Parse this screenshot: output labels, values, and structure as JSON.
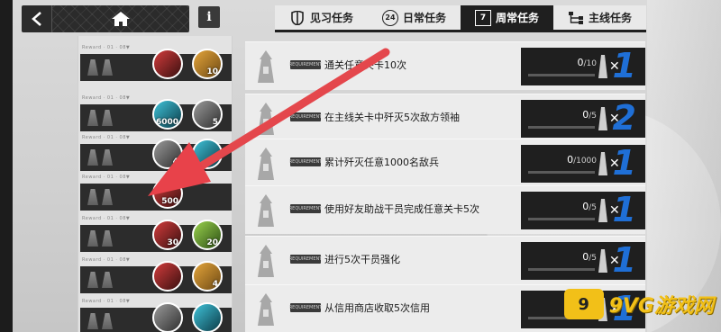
{
  "topbar": {
    "back_icon": "chevron-left-icon",
    "home_icon": "home-icon",
    "info_label": "i"
  },
  "tabs": [
    {
      "label": "见习任务",
      "icon": "trainee-icon",
      "active": false
    },
    {
      "label": "日常任务",
      "icon": "daily-24-icon",
      "icon_text": "24",
      "active": false
    },
    {
      "label": "周常任务",
      "icon": "weekly-calendar-icon",
      "icon_text": "7",
      "active": true
    },
    {
      "label": "主线任务",
      "icon": "mainline-tree-icon",
      "active": false
    }
  ],
  "reward_tag": "Reward · 01 · 08▼",
  "rewards": [
    {
      "items": [
        {
          "color": "red",
          "count": ""
        },
        {
          "color": "gold",
          "count": "10"
        }
      ]
    },
    {
      "items": [
        {
          "color": "cyan",
          "count": "6000"
        },
        {
          "color": "gray",
          "count": "5"
        }
      ]
    },
    {
      "items": [
        {
          "color": "gray",
          "count": "4"
        },
        {
          "color": "cyan",
          "count": ""
        }
      ]
    },
    {
      "items": [
        {
          "color": "red",
          "count": "500"
        }
      ]
    },
    {
      "items": [
        {
          "color": "red",
          "count": "30"
        },
        {
          "color": "green",
          "count": "20"
        }
      ]
    },
    {
      "items": [
        {
          "color": "red",
          "count": ""
        },
        {
          "color": "gold",
          "count": "4"
        }
      ]
    },
    {
      "items": [
        {
          "color": "gray",
          "count": ""
        },
        {
          "color": "cyan",
          "count": ""
        }
      ]
    }
  ],
  "mission_req_label": "REQUIREMENT",
  "missions": [
    {
      "desc": "通关任意关卡10次",
      "current": "0",
      "total": "/10",
      "progress": 0.0,
      "multiplier": "1"
    },
    {
      "desc": "在主线关卡中歼灭5次敌方领袖",
      "current": "0",
      "total": "/5",
      "progress": 0.0,
      "multiplier": "2"
    },
    {
      "desc": "累计歼灭任意1000名敌兵",
      "current": "0",
      "total": "/1000",
      "progress": 0.0,
      "multiplier": "1"
    },
    {
      "desc": "使用好友助战干员完成任意关卡5次",
      "current": "0",
      "total": "/5",
      "progress": 0.0,
      "multiplier": "1"
    },
    {
      "desc": "进行5次干员强化",
      "current": "0",
      "total": "/5",
      "progress": 0.0,
      "multiplier": "1"
    },
    {
      "desc": "从信用商店收取5次信用",
      "current": "0",
      "total": "/5",
      "progress": 0.0,
      "multiplier": "1"
    }
  ],
  "watermark": {
    "logo_text": "9",
    "text": "9VG游戏网"
  },
  "colors": {
    "accent_blue": "#1f6fd6",
    "arrow_red": "#e8424a",
    "dark": "#1f1f1f",
    "watermark": "#f2c018"
  }
}
